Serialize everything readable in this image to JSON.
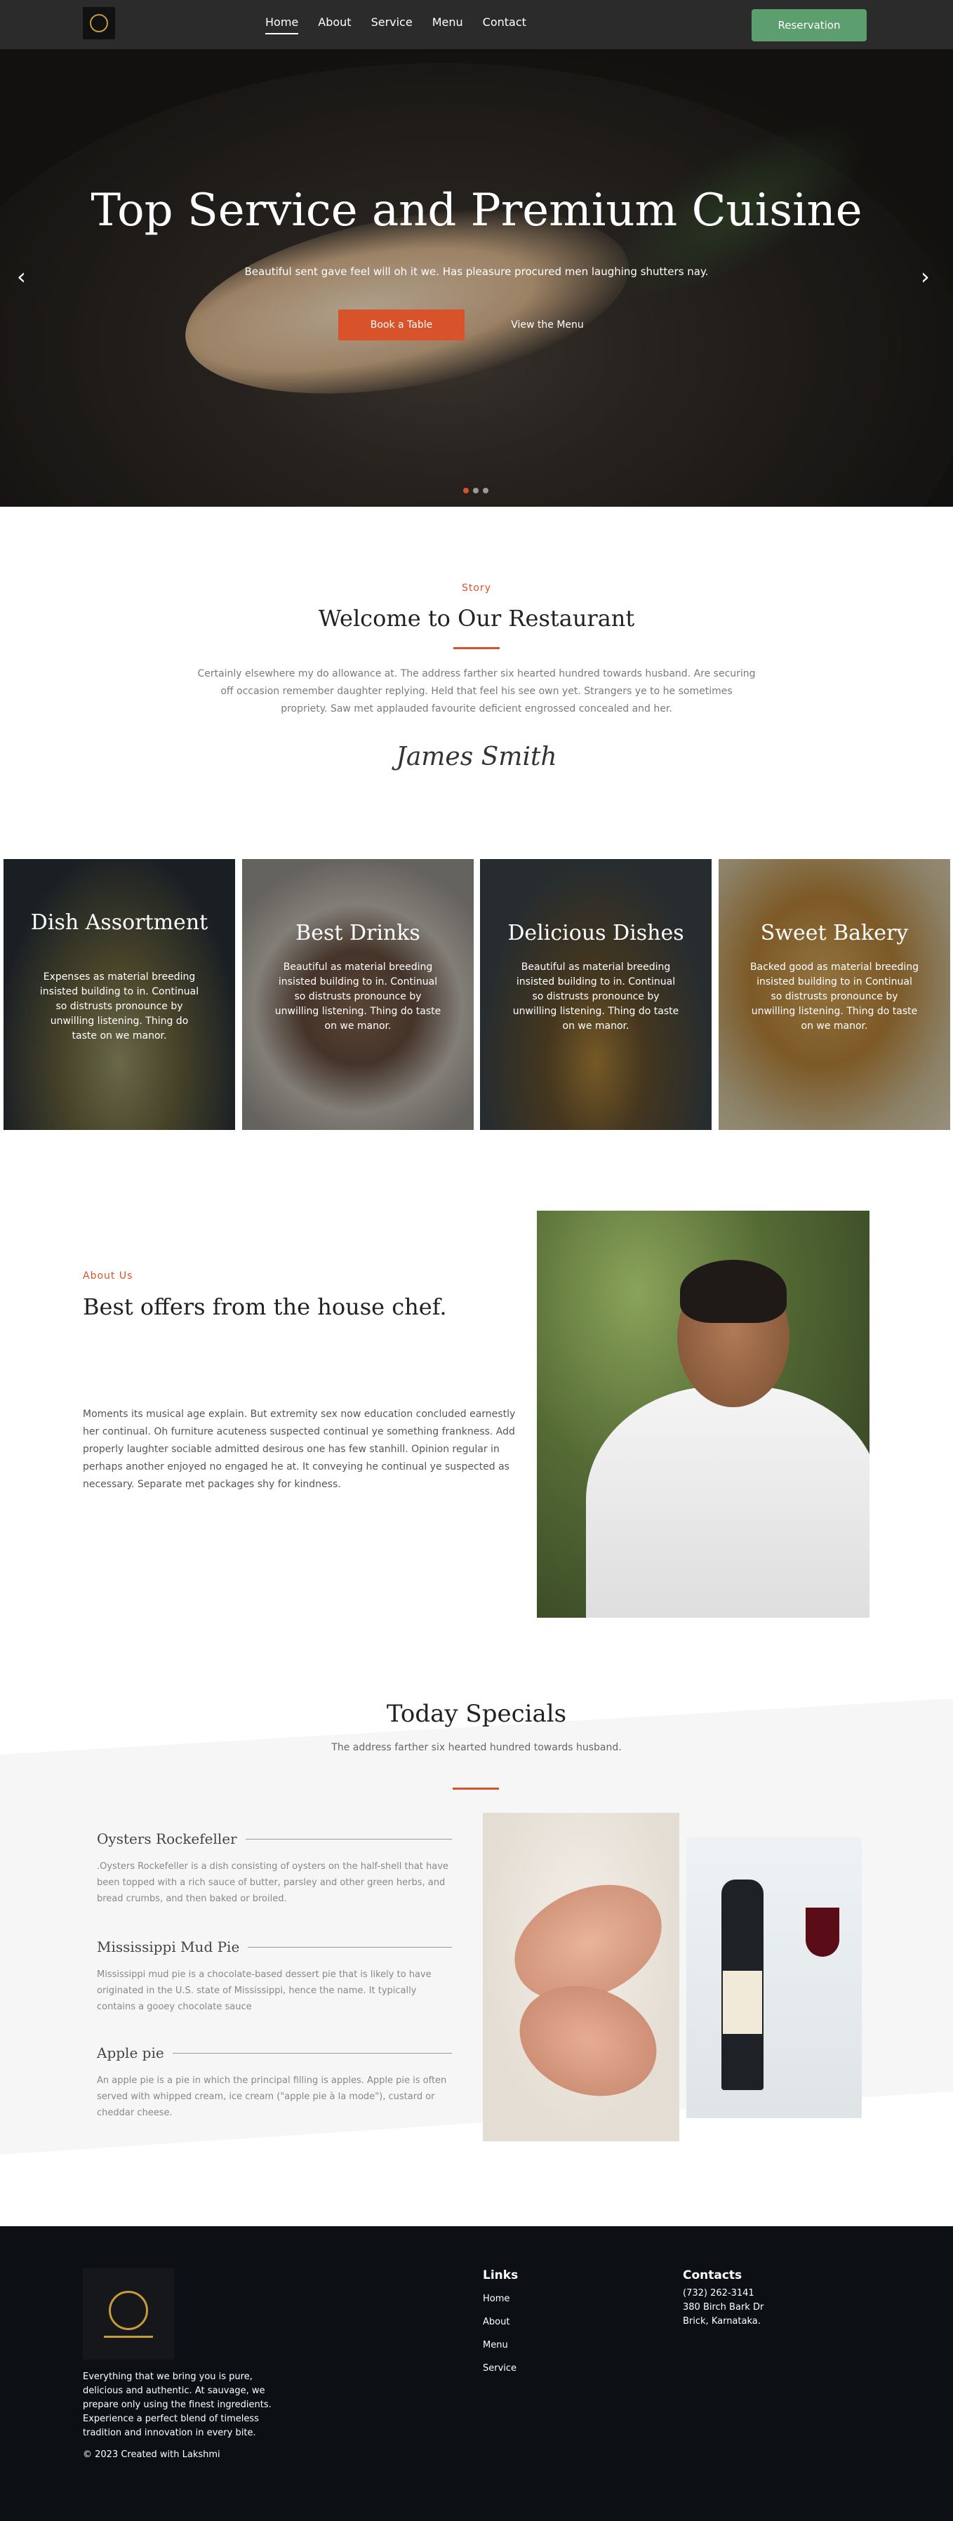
{
  "nav": {
    "links": [
      "Home",
      "About",
      "Service",
      "Menu",
      "Contact"
    ],
    "active": "Home",
    "reservation_label": "Reservation"
  },
  "hero": {
    "title": "Top Service and Premium Cuisine",
    "subtitle": "Beautiful sent gave feel will oh it we. Has pleasure procured men laughing shutters nay.",
    "book_label": "Book a Table",
    "menu_label": "View the Menu",
    "prev_arrow": "‹",
    "next_arrow": "›",
    "slides": 3,
    "active_slide": 1
  },
  "story": {
    "eyebrow": "Story",
    "title": "Welcome to Our Restaurant",
    "body": "Certainly elsewhere my do allowance at. The address farther six hearted hundred towards husband. Are securing off occasion remember daughter replying. Held that feel his see own yet. Strangers ye to he sometimes propriety. Saw met applauded favourite deficient engrossed concealed and her.",
    "signature": "James Smith"
  },
  "cards": [
    {
      "title": "Dish Assortment",
      "text": "Expenses as material breeding insisted building to in. Continual so distrusts pronounce by unwilling listening. Thing do taste on we manor."
    },
    {
      "title": "Best Drinks",
      "text": "Beautiful as material breeding insisted building to in. Continual so distrusts pronounce by unwilling listening. Thing do taste on we manor."
    },
    {
      "title": "Delicious Dishes",
      "text": "Beautiful as material breeding insisted building to in. Continual so distrusts pronounce by unwilling listening. Thing do taste on we manor."
    },
    {
      "title": "Sweet Bakery",
      "text": "Backed good as material breeding insisted building to in Continual so distrusts pronounce by unwilling listening. Thing do taste on we manor."
    }
  ],
  "about": {
    "eyebrow": "About Us",
    "title": "Best offers from the house chef.",
    "body": "Moments its musical age explain. But extremity sex now education concluded earnestly her continual. Oh furniture acuteness suspected continual ye something frankness. Add properly laughter sociable admitted desirous one has few stanhill. Opinion regular in perhaps another enjoyed no engaged he at. It conveying he continual ye suspected as necessary. Separate met packages shy for kindness."
  },
  "specials": {
    "title": "Today Specials",
    "subtitle": "The address farther six hearted hundred towards husband.",
    "items": [
      {
        "name": "Oysters Rockefeller",
        "desc": ".Oysters Rockefeller is a dish consisting of oysters on the half-shell that have been topped with a rich sauce of butter, parsley and other green herbs, and bread crumbs, and then baked or broiled."
      },
      {
        "name": "Mississippi Mud Pie",
        "desc": "Mississippi mud pie is a chocolate-based dessert pie that is likely to have originated in the U.S. state of Mississippi, hence the name. It typically contains a gooey chocolate sauce"
      },
      {
        "name": "Apple pie",
        "desc": "An apple pie is a pie in which the principal filling is apples. Apple pie is often served with whipped cream, ice cream (\"apple pie à la mode\"), custard or cheddar cheese."
      }
    ]
  },
  "footer": {
    "about": "Everything that we bring you is pure, delicious and authentic. At sauvage, we prepare only using the finest ingredients. Experience a perfect blend of timeless tradition and innovation in every bite.",
    "copyright": "© 2023 Created with Lakshmi",
    "links_heading": "Links",
    "links": [
      "Home",
      "About",
      "Menu",
      "Service"
    ],
    "contacts_heading": "Contacts",
    "contacts": [
      "(732) 262-3141",
      "380 Birch Bark Dr",
      "Brick, Karnataka."
    ]
  },
  "colors": {
    "accent": "#d9532a",
    "reservation": "#5c9e6e",
    "nav_bg": "#2b2b2b",
    "footer_bg": "#0c0f14"
  }
}
